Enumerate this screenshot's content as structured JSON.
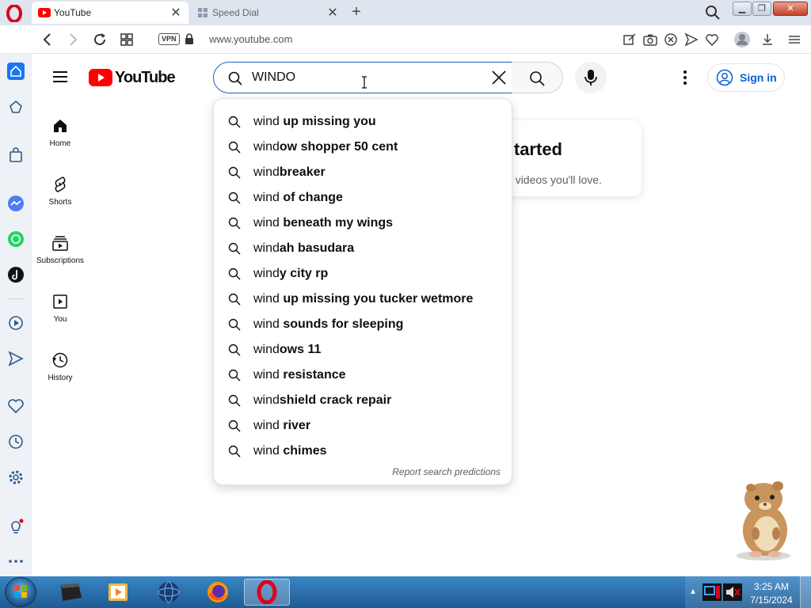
{
  "browser": {
    "tabs": [
      {
        "title": "YouTube",
        "active": true
      },
      {
        "title": "Speed Dial",
        "active": false
      }
    ],
    "address": {
      "vpn_label": "VPN",
      "url": "www.youtube.com"
    }
  },
  "youtube": {
    "logo_text": "YouTube",
    "search": {
      "value": "WINDO"
    },
    "signin_label": "Sign in",
    "guide": [
      {
        "label": "Home",
        "icon": "home-icon"
      },
      {
        "label": "Shorts",
        "icon": "shorts-icon"
      },
      {
        "label": "Subscriptions",
        "icon": "subscriptions-icon"
      },
      {
        "label": "You",
        "icon": "you-icon"
      },
      {
        "label": "History",
        "icon": "history-icon"
      }
    ],
    "background_card": {
      "title": "tarted",
      "description": "f videos you'll love."
    },
    "suggestions": [
      {
        "prefix": "wind",
        "suffix": " up missing you"
      },
      {
        "prefix": "wind",
        "suffix": "ow shopper 50 cent"
      },
      {
        "prefix": "wind",
        "suffix": "breaker"
      },
      {
        "prefix": "wind",
        "suffix": " of change"
      },
      {
        "prefix": "wind",
        "suffix": " beneath my wings"
      },
      {
        "prefix": "wind",
        "suffix": "ah basudara"
      },
      {
        "prefix": "wind",
        "suffix": "y city rp"
      },
      {
        "prefix": "wind",
        "suffix": " up missing you tucker wetmore"
      },
      {
        "prefix": "wind",
        "suffix": " sounds for sleeping"
      },
      {
        "prefix": "wind",
        "suffix": "ows 11"
      },
      {
        "prefix": "wind",
        "suffix": " resistance"
      },
      {
        "prefix": "wind",
        "suffix": "shield crack repair"
      },
      {
        "prefix": "wind",
        "suffix": " river"
      },
      {
        "prefix": "wind",
        "suffix": " chimes"
      }
    ],
    "report_label": "Report search predictions"
  },
  "taskbar": {
    "clock_time": "3:25 AM",
    "clock_date": "7/15/2024"
  },
  "colors": {
    "youtube_red": "#ff0000",
    "opera_red": "#e0001b",
    "link_blue": "#065fd4",
    "taskbar_blue": "#2a6fad"
  }
}
